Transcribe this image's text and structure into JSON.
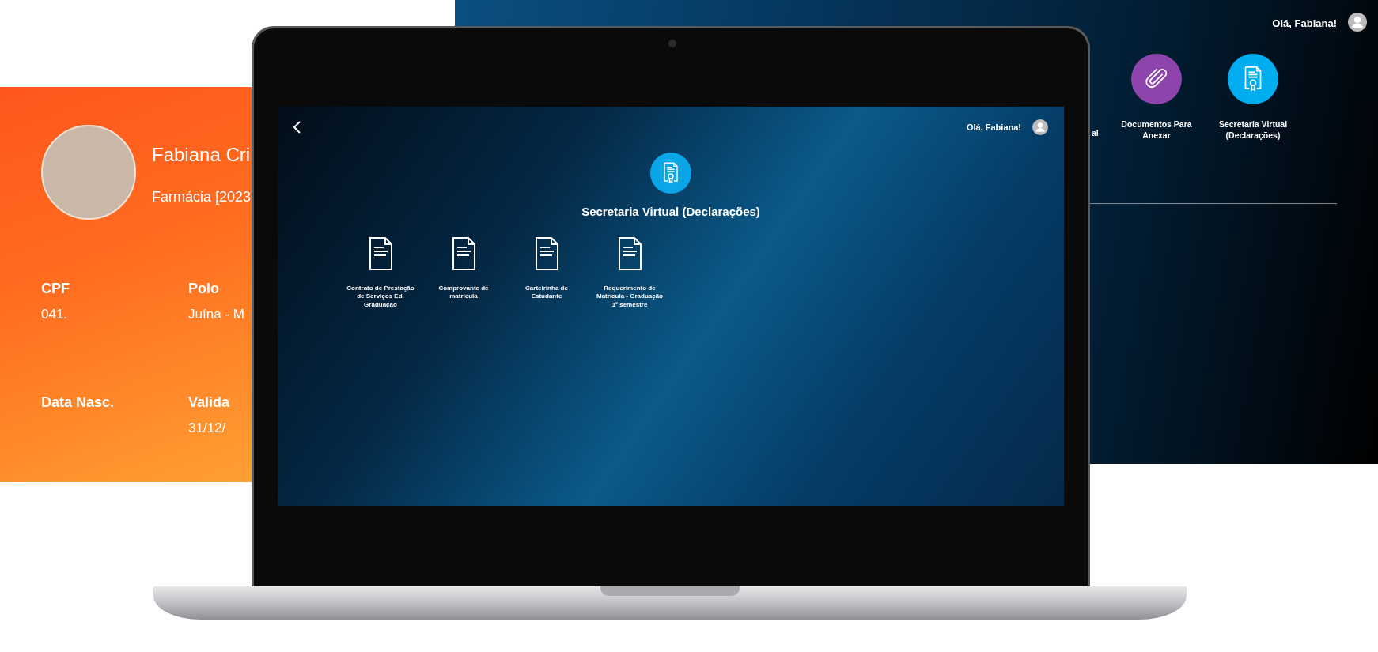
{
  "back_screen": {
    "greeting": "Olá, Fabiana!",
    "cut_tile_label": "al",
    "tiles": [
      {
        "label": "Documentos Para Anexar",
        "kind": "attach",
        "color": "#8e44ad"
      },
      {
        "label": "Secretaria Virtual (Declarações)",
        "kind": "certificate",
        "color": "#00aeef"
      }
    ]
  },
  "id_card": {
    "name": "Fabiana Cri",
    "course": "Farmácia [2023",
    "fields": [
      {
        "label": "CPF",
        "value": "041."
      },
      {
        "label": "Polo",
        "value": "Juína - M"
      },
      {
        "label": "Data Nasc."
      },
      {
        "label": "Valida",
        "value": "31/12/"
      }
    ]
  },
  "laptop_screen": {
    "greeting": "Olá, Fabiana!",
    "section_title": "Secretaria Virtual (Declarações)",
    "documents": [
      {
        "label": "Contrato de Prestação de Serviços Ed. Graduação"
      },
      {
        "label": "Comprovante de matrícula"
      },
      {
        "label": "Carteirinha de Estudante"
      },
      {
        "label": "Requerimento de Matrícula - Graduação 1º semestre"
      }
    ]
  }
}
